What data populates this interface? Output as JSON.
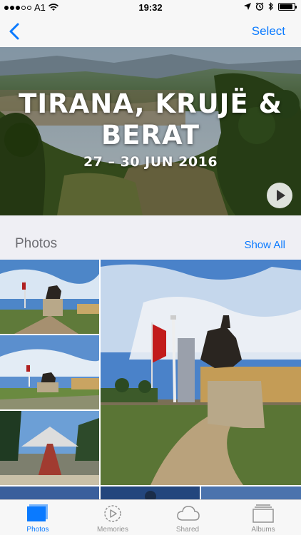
{
  "status_bar": {
    "carrier": "A1",
    "time": "19:32",
    "battery_level": 0.9
  },
  "nav": {
    "select_label": "Select"
  },
  "hero": {
    "title_line1": "TIRANA, KRUJË &",
    "title_line2": "BERAT",
    "date_range": "27 – 30 JUN 2016"
  },
  "section": {
    "title": "Photos",
    "show_all_label": "Show All"
  },
  "tabs": [
    {
      "label": "Photos",
      "icon": "photos-icon",
      "active": true
    },
    {
      "label": "Memories",
      "icon": "memories-icon",
      "active": false
    },
    {
      "label": "Shared",
      "icon": "cloud-icon",
      "active": false
    },
    {
      "label": "Albums",
      "icon": "albums-icon",
      "active": false
    }
  ],
  "colors": {
    "accent": "#0a7aff",
    "inactive_tab": "#929292",
    "background": "#efeff4"
  }
}
